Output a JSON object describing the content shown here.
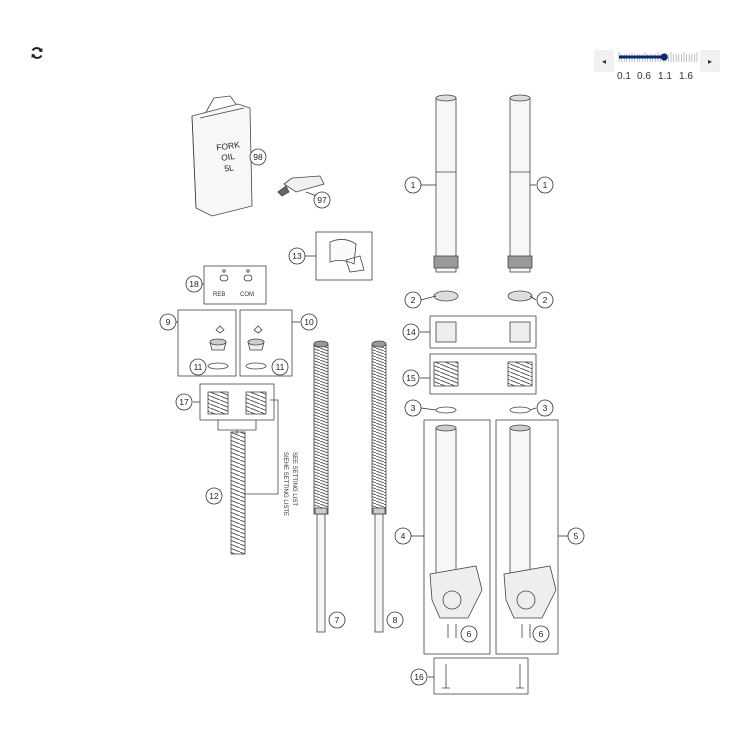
{
  "toolbar": {
    "refresh_icon": "refresh-icon",
    "zoom": {
      "prev_glyph": "◂",
      "next_glyph": "▸",
      "ticks": [
        "0.1",
        "0.6",
        "1.1",
        "1.6"
      ],
      "level_fraction": 0.58
    }
  },
  "diagram": {
    "can_text": [
      "FORK",
      "OIL",
      "5L"
    ],
    "valve_labels": [
      "REB",
      "COM"
    ],
    "spring_list_text": [
      "SIEHE SETTING LISTE",
      "SEE SETTING LIST"
    ],
    "callouts": {
      "c98": "98",
      "c97": "97",
      "c13": "13",
      "c18": "18",
      "c9": "9",
      "c10": "10",
      "c11a": "11",
      "c11b": "11",
      "c17": "17",
      "c12": "12",
      "c7": "7",
      "c8": "8",
      "c1a": "1",
      "c1b": "1",
      "c2a": "2",
      "c2b": "2",
      "c14": "14",
      "c15": "15",
      "c3a": "3",
      "c3b": "3",
      "c4": "4",
      "c5": "5",
      "c6a": "6",
      "c6b": "6",
      "c16": "16"
    }
  }
}
